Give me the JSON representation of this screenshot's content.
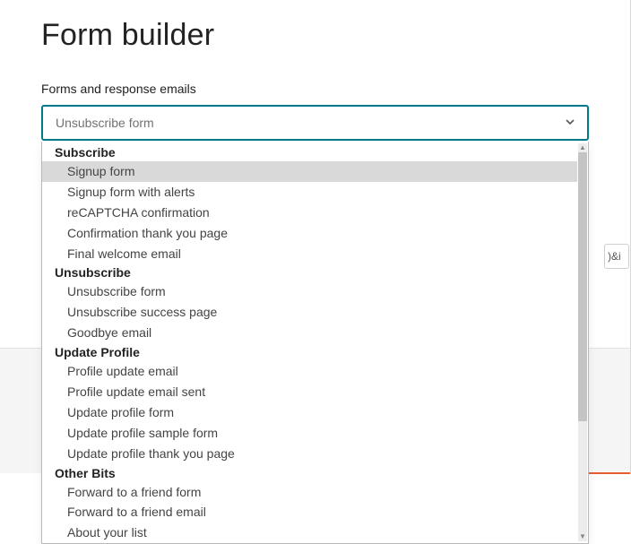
{
  "title": "Form builder",
  "section_label": "Forms and response emails",
  "select": {
    "value": "Unsubscribe form"
  },
  "peek_button_text": ")&i",
  "groups": [
    {
      "name": "Subscribe",
      "options": [
        {
          "label": "Signup form",
          "highlight": true
        },
        {
          "label": "Signup form with alerts"
        },
        {
          "label": "reCAPTCHA confirmation"
        },
        {
          "label": "Confirmation thank you page"
        },
        {
          "label": "Final welcome email"
        }
      ]
    },
    {
      "name": "Unsubscribe",
      "options": [
        {
          "label": "Unsubscribe form"
        },
        {
          "label": "Unsubscribe success page"
        },
        {
          "label": "Goodbye email"
        }
      ]
    },
    {
      "name": "Update Profile",
      "options": [
        {
          "label": "Profile update email"
        },
        {
          "label": "Profile update email sent"
        },
        {
          "label": "Update profile form"
        },
        {
          "label": "Update profile sample form"
        },
        {
          "label": "Update profile thank you page"
        }
      ]
    },
    {
      "name": "Other Bits",
      "options": [
        {
          "label": "Forward to a friend form"
        },
        {
          "label": "Forward to a friend email"
        },
        {
          "label": "About your list"
        }
      ]
    }
  ]
}
